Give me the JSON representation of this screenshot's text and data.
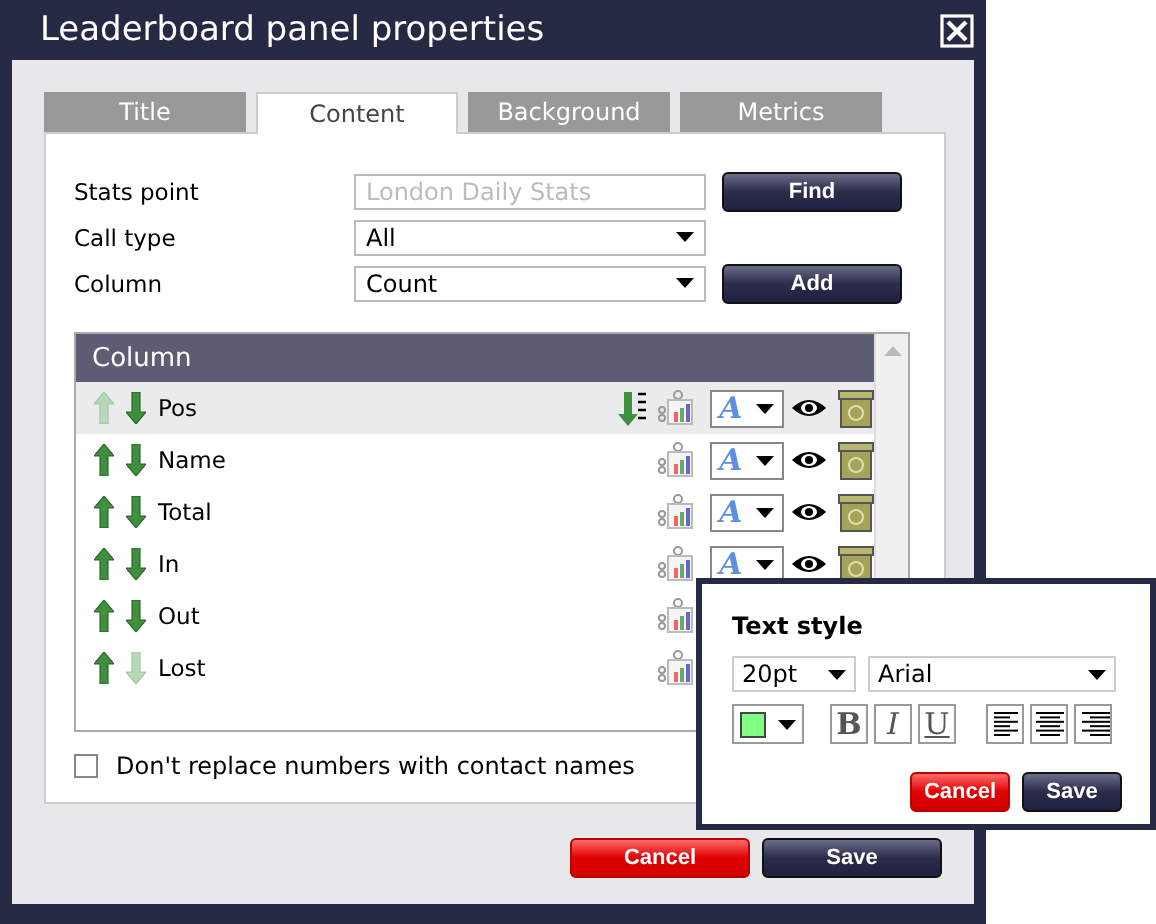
{
  "window": {
    "title": "Leaderboard panel properties"
  },
  "tabs": [
    {
      "label": "Title",
      "selected": false
    },
    {
      "label": "Content",
      "selected": true
    },
    {
      "label": "Background",
      "selected": false
    },
    {
      "label": "Metrics",
      "selected": false
    }
  ],
  "form": {
    "stats_point": {
      "label": "Stats point",
      "placeholder": "London Daily Stats"
    },
    "find_button": "Find",
    "call_type": {
      "label": "Call type",
      "value": "All"
    },
    "column": {
      "label": "Column",
      "value": "Count"
    },
    "add_button": "Add"
  },
  "grid": {
    "header": "Column",
    "rows": [
      {
        "name": "Pos",
        "selected": true,
        "up_enabled": false,
        "down_enabled": true,
        "sorted": true,
        "format_label": "A"
      },
      {
        "name": "Name",
        "selected": false,
        "up_enabled": true,
        "down_enabled": true,
        "sorted": false,
        "format_label": "A"
      },
      {
        "name": "Total",
        "selected": false,
        "up_enabled": true,
        "down_enabled": true,
        "sorted": false,
        "format_label": "A"
      },
      {
        "name": "In",
        "selected": false,
        "up_enabled": true,
        "down_enabled": true,
        "sorted": false,
        "format_label": "A"
      },
      {
        "name": "Out",
        "selected": false,
        "up_enabled": true,
        "down_enabled": true,
        "sorted": false
      },
      {
        "name": "Lost",
        "selected": false,
        "up_enabled": true,
        "down_enabled": false,
        "sorted": false
      }
    ]
  },
  "checkbox": {
    "label": "Don't replace numbers with contact names",
    "checked": false
  },
  "buttons": [
    {
      "label": "Cancel",
      "kind": "cancel"
    },
    {
      "label": "Save",
      "kind": "save"
    }
  ],
  "text_style": {
    "title": "Text style",
    "size": "20pt",
    "font": "Arial",
    "color": "#80ff80",
    "format_buttons": [
      {
        "label": "B",
        "kind": "bold"
      },
      {
        "label": "I",
        "kind": "italic"
      },
      {
        "label": "U",
        "kind": "underline"
      }
    ],
    "align_buttons": [
      {
        "kind": "left"
      },
      {
        "kind": "center"
      },
      {
        "kind": "right"
      }
    ],
    "buttons": [
      {
        "label": "Cancel",
        "kind": "cancel"
      },
      {
        "label": "Save",
        "kind": "save"
      }
    ]
  }
}
